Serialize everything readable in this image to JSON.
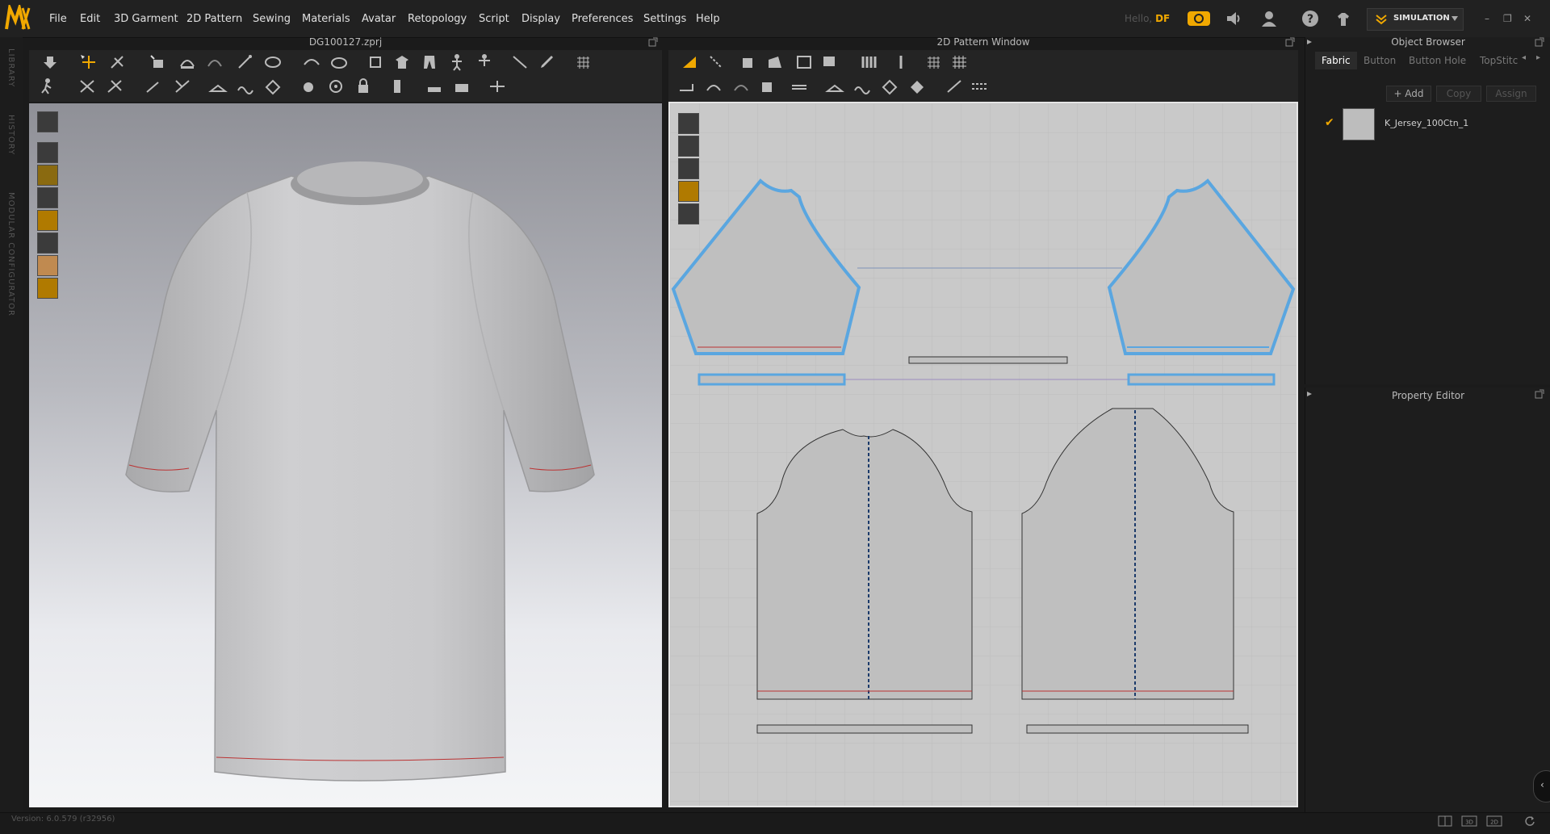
{
  "app": {
    "logo": "MD",
    "menu": [
      "File",
      "Edit",
      "3D Garment",
      "2D Pattern",
      "Sewing",
      "Materials",
      "Avatar",
      "Retopology",
      "Script",
      "Display",
      "Preferences",
      "Settings",
      "Help"
    ],
    "hello_prefix": "Hello,",
    "user": "DF",
    "mode": "SIMULATION",
    "accent": "#f0a800"
  },
  "panels": {
    "file_title": "DG100127.zprj",
    "pattern_title": "2D Pattern Window",
    "object_browser_title": "Object Browser",
    "property_editor_title": "Property Editor"
  },
  "left_strip": [
    "LIBRARY",
    "HISTORY",
    "MODULAR CONFIGURATOR"
  ],
  "object_browser": {
    "tabs": [
      "Fabric",
      "Button",
      "Button Hole",
      "TopStitc"
    ],
    "active_tab": "Fabric",
    "buttons": {
      "add": "+ Add",
      "copy": "Copy",
      "assign": "Assign"
    },
    "fabrics": [
      {
        "name": "K_Jersey_100Ctn_1",
        "checked": true
      }
    ]
  },
  "status": {
    "version": "Version: 6.0.579 (r32956)"
  },
  "colors": {
    "selection": "#5aa6e0",
    "stitch": "#b33",
    "fabric": "#bfbfbf"
  }
}
